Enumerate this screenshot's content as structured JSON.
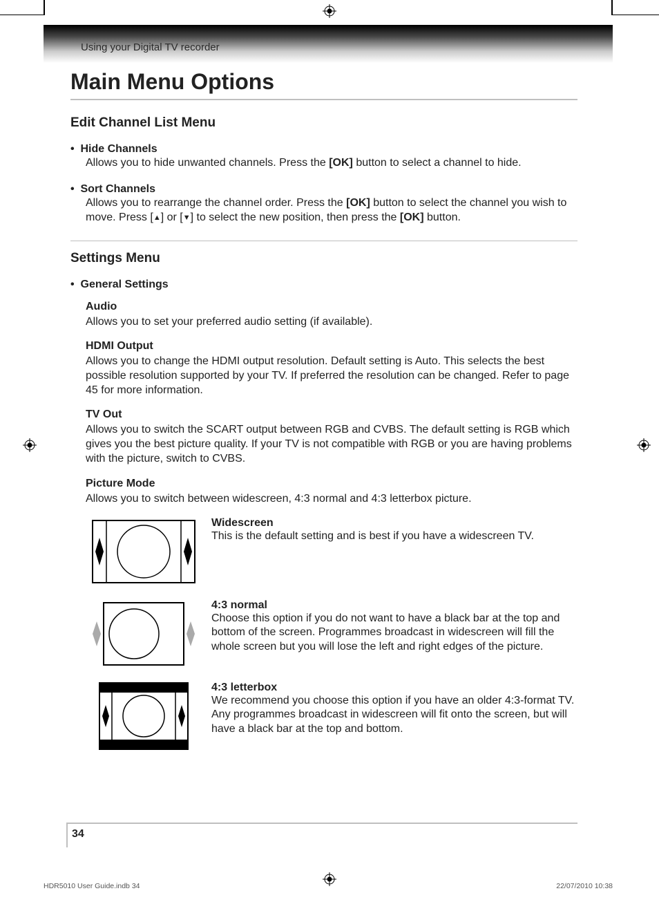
{
  "header": {
    "section": "Using your Digital TV recorder"
  },
  "title": "Main Menu Options",
  "edit_channel": {
    "heading": "Edit Channel List Menu",
    "hide_label": "Hide Channels",
    "hide_text_1": "Allows you to hide unwanted channels. Press the ",
    "hide_ok": "[OK]",
    "hide_text_2": " button to select a channel to hide.",
    "sort_label": "Sort Channels",
    "sort_text_1": "Allows you to rearrange the channel order. Press the ",
    "sort_ok1": "[OK]",
    "sort_text_2": " button to select the channel you wish to move. Press [",
    "sort_up": "▲",
    "sort_text_3": "] or [",
    "sort_down": "▼",
    "sort_text_4": "] to select the new position, then press the ",
    "sort_ok2": "[OK]",
    "sort_text_5": " button."
  },
  "settings": {
    "heading": "Settings Menu",
    "general_label": "General Settings",
    "audio_title": "Audio",
    "audio_body": "Allows you to set your preferred audio setting (if available).",
    "hdmi_title": "HDMI Output",
    "hdmi_body": "Allows you to change the HDMI output resolution. Default setting is Auto. This selects the best possible resolution supported by your TV. If preferred the resolution can be changed. Refer to page 45 for more information.",
    "tvout_title": "TV Out",
    "tvout_body": "Allows you to switch the SCART output between RGB and CVBS. The default setting is RGB which gives you the best picture quality. If your TV is not compatible with RGB or you are having problems with the picture, switch to CVBS.",
    "picmode_title": "Picture Mode",
    "picmode_body": "Allows you to switch between widescreen, 4:3 normal and 4:3 letterbox picture.",
    "wide_title": "Widescreen",
    "wide_body": "This is the default setting and is best if you have a widescreen TV.",
    "normal_title": "4:3 normal",
    "normal_body": "Choose this option if you do not want to have a black bar at the top and bottom of the screen. Programmes broadcast in widescreen will fill the whole screen but you will lose the left and right edges of the picture.",
    "letterbox_title": "4:3 letterbox",
    "letterbox_body": "We recommend you choose this option if you have an older 4:3-format TV. Any programmes broadcast in widescreen will fit onto the screen, but will have a black bar at the top and bottom."
  },
  "page_number": "34",
  "doc_footer": {
    "file": "HDR5010 User Guide.indb   34",
    "datetime": "22/07/2010   10:38"
  }
}
